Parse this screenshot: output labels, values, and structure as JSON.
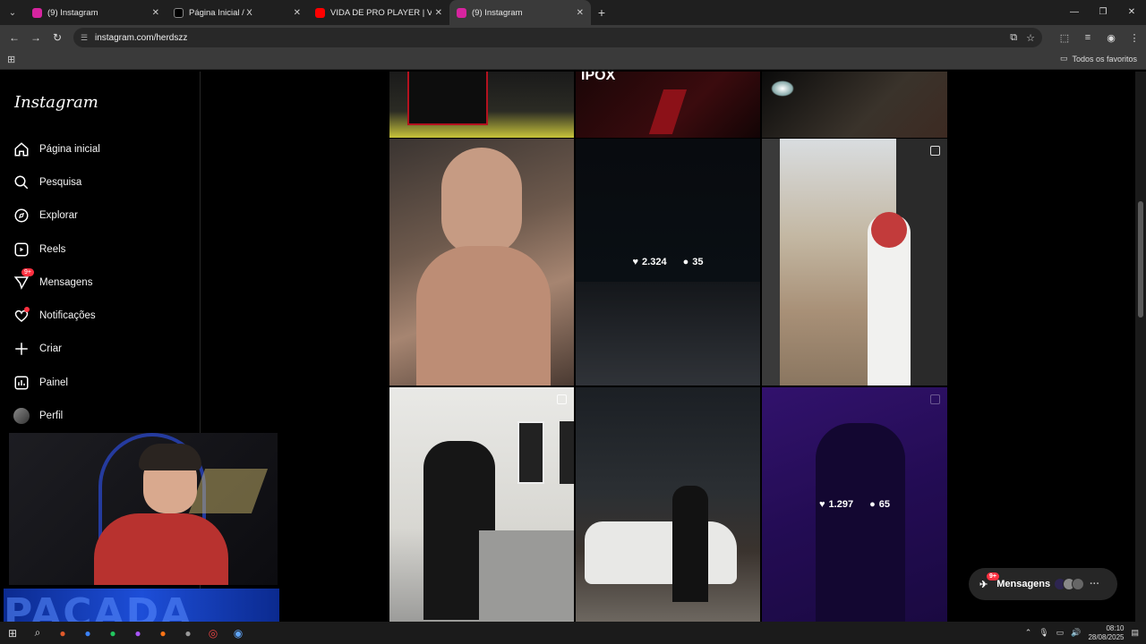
{
  "browser": {
    "tabs": [
      {
        "title": "(9) Instagram",
        "active": false,
        "color": "#d6249f"
      },
      {
        "title": "Página Inicial / X",
        "active": false,
        "color": "#000000"
      },
      {
        "title": "VIDA DE PRO PLAYER | VLOG -",
        "active": false,
        "color": "#ff0000"
      },
      {
        "title": "(9) Instagram",
        "active": true,
        "color": "#d6249f"
      }
    ],
    "url": "instagram.com/herdszz",
    "bookmarks_folder": "Todos os favoritos"
  },
  "instagram": {
    "logo": "Instagram",
    "nav": [
      {
        "label": "Página inicial",
        "icon": "home-icon"
      },
      {
        "label": "Pesquisa",
        "icon": "search-icon"
      },
      {
        "label": "Explorar",
        "icon": "compass-icon"
      },
      {
        "label": "Reels",
        "icon": "reels-icon"
      },
      {
        "label": "Mensagens",
        "icon": "messenger-icon",
        "badge": "9+"
      },
      {
        "label": "Notificações",
        "icon": "heart-icon"
      },
      {
        "label": "Criar",
        "icon": "plus-icon"
      },
      {
        "label": "Painel",
        "icon": "dashboard-icon"
      },
      {
        "label": "Perfil",
        "icon": "avatar"
      }
    ],
    "posts": [
      {
        "likes": "2.324",
        "comments": "35"
      },
      {
        "likes": "1.297",
        "comments": "65"
      }
    ],
    "messages_pill": {
      "label": "Mensagens",
      "badge": "9+"
    }
  },
  "stream": {
    "banner_text": "PACADA"
  },
  "taskbar": {
    "time": "08:10",
    "date": "28/08/2025"
  }
}
